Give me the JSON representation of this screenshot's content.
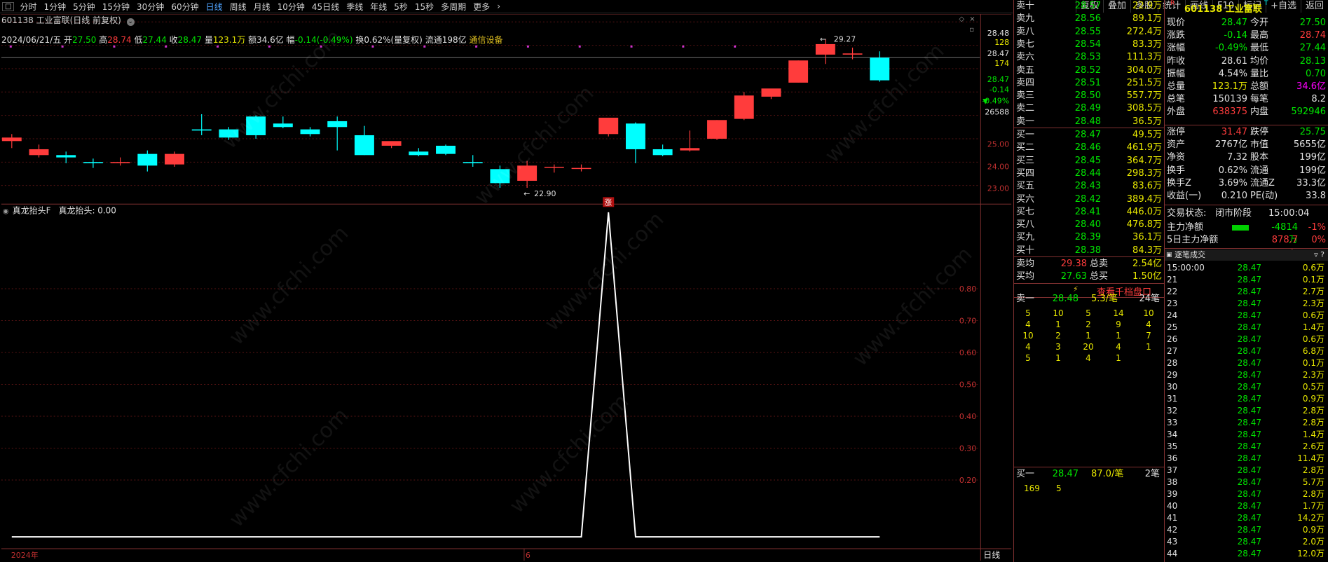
{
  "toolbar": {
    "periods": [
      "分时",
      "1分钟",
      "5分钟",
      "15分钟",
      "30分钟",
      "60分钟",
      "日线",
      "周线",
      "月线",
      "10分钟",
      "45日线",
      "季线",
      "年线",
      "5秒",
      "15秒",
      "多周期",
      "更多"
    ],
    "active_period": "日线",
    "right_tools": [
      "复权",
      "叠加",
      "多股",
      "统计",
      "画线",
      "F10",
      "标记",
      "+自选",
      "返回"
    ]
  },
  "security": {
    "code": "601138",
    "name": "工业富联",
    "title": "601138 工业富联(日线 前复权)"
  },
  "info_line": {
    "date": "2024/06/21/五",
    "open_label": "开",
    "open": "27.50",
    "high_label": "高",
    "high": "28.74",
    "low_label": "低",
    "low": "27.44",
    "close_label": "收",
    "close": "28.47",
    "vol_label": "量",
    "vol": "123.1万",
    "amount_label": "额",
    "amount": "34.6亿",
    "chg_label": "幅",
    "chg": "-0.14(-0.49%)",
    "turnover_label": "换",
    "turnover": "0.62%(量复权)",
    "float_label": "流通",
    "float": "198亿",
    "industry": "通信设备"
  },
  "price_axis": {
    "top": "28.48",
    "r2": "128",
    "r3": "28.47",
    "r4": "174",
    "r5": "28.47",
    "r6": "-0.14",
    "r7": "-0.49%",
    "r8": "26588",
    "l25": "25.00",
    "l24": "24.00",
    "l23": "23.00"
  },
  "chart_annotations": {
    "high_mark": "29.27",
    "low_mark": "22.90",
    "rise_badge": "涨"
  },
  "indicator": {
    "name": "真龙抬头F",
    "label": "真龙抬头: 0.00",
    "ticks": [
      "0.80",
      "0.70",
      "0.60",
      "0.50",
      "0.40",
      "0.30",
      "0.20"
    ]
  },
  "x_axis": {
    "start": "2024年",
    "mid": "6",
    "period_label": "日线"
  },
  "chart_data": {
    "type": "candlestick",
    "ylim": [
      22.5,
      29.5
    ],
    "candles": [
      {
        "o": 24.9,
        "h": 25.2,
        "l": 24.6,
        "c": 25.05
      },
      {
        "o": 24.3,
        "h": 24.75,
        "l": 24.2,
        "c": 24.55
      },
      {
        "o": 24.3,
        "h": 24.45,
        "l": 23.95,
        "c": 24.2
      },
      {
        "o": 24.0,
        "h": 24.15,
        "l": 23.75,
        "c": 23.95
      },
      {
        "o": 23.95,
        "h": 24.2,
        "l": 23.85,
        "c": 24.0
      },
      {
        "o": 24.35,
        "h": 24.5,
        "l": 23.6,
        "c": 23.85
      },
      {
        "o": 23.9,
        "h": 24.45,
        "l": 23.8,
        "c": 24.35
      },
      {
        "o": 25.4,
        "h": 26.05,
        "l": 25.15,
        "c": 25.35
      },
      {
        "o": 25.4,
        "h": 25.5,
        "l": 24.95,
        "c": 25.05
      },
      {
        "o": 25.95,
        "h": 26.0,
        "l": 25.0,
        "c": 25.15
      },
      {
        "o": 25.65,
        "h": 25.95,
        "l": 25.45,
        "c": 25.5
      },
      {
        "o": 25.4,
        "h": 25.5,
        "l": 25.1,
        "c": 25.2
      },
      {
        "o": 25.75,
        "h": 25.95,
        "l": 24.5,
        "c": 25.5
      },
      {
        "o": 25.15,
        "h": 25.55,
        "l": 24.3,
        "c": 24.3
      },
      {
        "o": 24.7,
        "h": 24.8,
        "l": 24.6,
        "c": 24.9
      },
      {
        "o": 24.45,
        "h": 24.6,
        "l": 24.25,
        "c": 24.3
      },
      {
        "o": 24.7,
        "h": 24.75,
        "l": 24.3,
        "c": 24.35
      },
      {
        "o": 24.0,
        "h": 24.3,
        "l": 23.8,
        "c": 23.95
      },
      {
        "o": 23.7,
        "h": 23.85,
        "l": 22.9,
        "c": 23.1
      },
      {
        "o": 23.2,
        "h": 24.05,
        "l": 22.9,
        "c": 23.85
      },
      {
        "o": 23.8,
        "h": 23.9,
        "l": 23.55,
        "c": 23.8
      },
      {
        "o": 23.75,
        "h": 23.9,
        "l": 23.6,
        "c": 23.75
      },
      {
        "o": 25.2,
        "h": 25.9,
        "l": 25.1,
        "c": 25.9
      },
      {
        "o": 25.65,
        "h": 25.7,
        "l": 23.95,
        "c": 24.55
      },
      {
        "o": 24.55,
        "h": 24.75,
        "l": 24.25,
        "c": 24.3
      },
      {
        "o": 24.5,
        "h": 25.35,
        "l": 24.45,
        "c": 24.6
      },
      {
        "o": 25.0,
        "h": 25.8,
        "l": 24.95,
        "c": 25.8
      },
      {
        "o": 25.85,
        "h": 27.0,
        "l": 25.8,
        "c": 26.85
      },
      {
        "o": 26.8,
        "h": 27.1,
        "l": 26.7,
        "c": 27.15
      },
      {
        "o": 27.4,
        "h": 28.35,
        "l": 27.4,
        "c": 28.35
      },
      {
        "o": 28.6,
        "h": 29.27,
        "l": 28.2,
        "c": 29.05
      },
      {
        "o": 28.6,
        "h": 28.9,
        "l": 28.4,
        "c": 28.65
      },
      {
        "o": 28.47,
        "h": 28.74,
        "l": 27.44,
        "c": 27.5
      }
    ],
    "indicator_series": [
      0,
      0,
      0,
      0,
      0,
      0,
      0,
      0,
      0,
      0,
      0,
      0,
      0,
      0,
      0,
      0,
      0,
      0,
      0,
      0,
      0,
      0,
      1,
      0,
      0,
      0,
      0,
      0,
      0,
      0,
      0,
      0,
      0
    ]
  },
  "book": {
    "sells": [
      {
        "label": "卖十",
        "px": "28.57",
        "vol": "22.9万"
      },
      {
        "label": "卖九",
        "px": "28.56",
        "vol": "89.1万"
      },
      {
        "label": "卖八",
        "px": "28.55",
        "vol": "272.4万"
      },
      {
        "label": "卖七",
        "px": "28.54",
        "vol": "83.3万"
      },
      {
        "label": "卖六",
        "px": "28.53",
        "vol": "111.3万"
      },
      {
        "label": "卖五",
        "px": "28.52",
        "vol": "304.0万"
      },
      {
        "label": "卖四",
        "px": "28.51",
        "vol": "251.5万"
      },
      {
        "label": "卖三",
        "px": "28.50",
        "vol": "557.7万"
      },
      {
        "label": "卖二",
        "px": "28.49",
        "vol": "308.5万"
      },
      {
        "label": "卖一",
        "px": "28.48",
        "vol": "36.5万"
      }
    ],
    "buys": [
      {
        "label": "买一",
        "px": "28.47",
        "vol": "49.5万"
      },
      {
        "label": "买二",
        "px": "28.46",
        "vol": "461.9万"
      },
      {
        "label": "买三",
        "px": "28.45",
        "vol": "364.7万"
      },
      {
        "label": "买四",
        "px": "28.44",
        "vol": "298.3万"
      },
      {
        "label": "买五",
        "px": "28.43",
        "vol": "83.6万"
      },
      {
        "label": "买六",
        "px": "28.42",
        "vol": "389.4万"
      },
      {
        "label": "买七",
        "px": "28.41",
        "vol": "446.0万"
      },
      {
        "label": "买八",
        "px": "28.40",
        "vol": "476.8万"
      },
      {
        "label": "买九",
        "px": "28.39",
        "vol": "36.1万"
      },
      {
        "label": "买十",
        "px": "28.38",
        "vol": "84.3万"
      }
    ],
    "avg_sell_label": "卖均",
    "avg_sell": "29.38",
    "total_sell_label": "总卖",
    "total_sell": "2.54亿",
    "avg_buy_label": "买均",
    "avg_buy": "27.63",
    "total_buy_label": "总买",
    "total_buy": "1.50亿",
    "thousand_link": "查看千档盘口",
    "sell1_label": "卖一",
    "sell1_px": "28.48",
    "sell1_avg": "5.3/笔",
    "sell1_count": "24笔",
    "sell1_queue": [
      [
        "5",
        "10",
        "5",
        "14",
        "10"
      ],
      [
        "4",
        "1",
        "2",
        "9",
        "4"
      ],
      [
        "10",
        "2",
        "1",
        "1",
        "7"
      ],
      [
        "4",
        "3",
        "20",
        "4",
        "1"
      ],
      [
        "5",
        "1",
        "4",
        "1",
        ""
      ]
    ],
    "buy1_label": "买一",
    "buy1_px": "28.47",
    "buy1_avg": "87.0/笔",
    "buy1_count": "2笔",
    "buy1_queue": [
      "169",
      "5"
    ]
  },
  "quote": {
    "title": "601138 工业富联",
    "rows": [
      {
        "l1": "现价",
        "v1": "28.47",
        "c1": "green",
        "l2": "今开",
        "v2": "27.50",
        "c2": "green"
      },
      {
        "l1": "涨跌",
        "v1": "-0.14",
        "c1": "green",
        "l2": "最高",
        "v2": "28.74",
        "c2": "red"
      },
      {
        "l1": "涨幅",
        "v1": "-0.49%",
        "c1": "green",
        "l2": "最低",
        "v2": "27.44",
        "c2": "green"
      },
      {
        "l1": "昨收",
        "v1": "28.61",
        "c1": "white",
        "l2": "均价",
        "v2": "28.13",
        "c2": "green"
      },
      {
        "l1": "振幅",
        "v1": "4.54%",
        "c1": "white",
        "l2": "量比",
        "v2": "0.70",
        "c2": "green"
      },
      {
        "l1": "总量",
        "v1": "123.1万",
        "c1": "yellow",
        "l2": "总额",
        "v2": "34.6亿",
        "c2": "mag"
      },
      {
        "l1": "总笔",
        "v1": "150139",
        "c1": "white",
        "l2": "每笔",
        "v2": "8.2",
        "c2": "white"
      },
      {
        "l1": "外盘",
        "v1": "638375",
        "c1": "red",
        "l2": "内盘",
        "v2": "592946",
        "c2": "green"
      }
    ],
    "rows2": [
      {
        "l1": "涨停",
        "v1": "31.47",
        "c1": "red",
        "l2": "跌停",
        "v2": "25.75",
        "c2": "green"
      },
      {
        "l1": "资产",
        "v1": "2767亿",
        "c1": "white",
        "l2": "市值",
        "v2": "5655亿",
        "c2": "white"
      },
      {
        "l1": "净资",
        "v1": "7.32",
        "c1": "white",
        "l2": "股本",
        "v2": "199亿",
        "c2": "white"
      },
      {
        "l1": "换手",
        "v1": "0.62%",
        "c1": "white",
        "l2": "流通",
        "v2": "199亿",
        "c2": "white"
      },
      {
        "l1": "换手Z",
        "v1": "3.69%",
        "c1": "white",
        "l2": "流通Z",
        "v2": "33.3亿",
        "c2": "white"
      },
      {
        "l1": "收益(一)",
        "v1": "0.210",
        "c1": "white",
        "l2": "PE(动)",
        "v2": "33.8",
        "c2": "white"
      }
    ],
    "trade_state_label": "交易状态:",
    "trade_state": "闭市阶段",
    "trade_time": "15:00:04",
    "main_net_label": "主力净额",
    "main_net": "-4814万",
    "main_net_pct": "-1%",
    "main5_label": "5日主力净额",
    "main5": "878.7万",
    "main5_pct": "0%",
    "ticks_title": "逐笔成交",
    "ticks": [
      {
        "t": "15:00:00",
        "p": "28.47",
        "v": "0.6万"
      },
      {
        "t": "21",
        "p": "28.47",
        "v": "0.1万"
      },
      {
        "t": "22",
        "p": "28.47",
        "v": "2.7万"
      },
      {
        "t": "23",
        "p": "28.47",
        "v": "2.3万"
      },
      {
        "t": "24",
        "p": "28.47",
        "v": "0.6万"
      },
      {
        "t": "25",
        "p": "28.47",
        "v": "1.4万"
      },
      {
        "t": "26",
        "p": "28.47",
        "v": "0.6万"
      },
      {
        "t": "27",
        "p": "28.47",
        "v": "6.8万"
      },
      {
        "t": "28",
        "p": "28.47",
        "v": "0.1万"
      },
      {
        "t": "29",
        "p": "28.47",
        "v": "2.3万"
      },
      {
        "t": "30",
        "p": "28.47",
        "v": "0.5万"
      },
      {
        "t": "31",
        "p": "28.47",
        "v": "0.9万"
      },
      {
        "t": "32",
        "p": "28.47",
        "v": "2.8万"
      },
      {
        "t": "33",
        "p": "28.47",
        "v": "2.8万"
      },
      {
        "t": "34",
        "p": "28.47",
        "v": "1.4万"
      },
      {
        "t": "35",
        "p": "28.47",
        "v": "2.6万"
      },
      {
        "t": "36",
        "p": "28.47",
        "v": "11.4万"
      },
      {
        "t": "37",
        "p": "28.47",
        "v": "2.8万"
      },
      {
        "t": "38",
        "p": "28.47",
        "v": "5.7万"
      },
      {
        "t": "39",
        "p": "28.47",
        "v": "2.8万"
      },
      {
        "t": "40",
        "p": "28.47",
        "v": "1.7万"
      },
      {
        "t": "41",
        "p": "28.47",
        "v": "14.2万"
      },
      {
        "t": "42",
        "p": "28.47",
        "v": "0.9万"
      },
      {
        "t": "43",
        "p": "28.47",
        "v": "2.0万"
      },
      {
        "t": "44",
        "p": "28.47",
        "v": "12.0万"
      }
    ]
  },
  "watermark": "www.cfchi.com",
  "colors": {
    "up": "#ff3c3c",
    "down": "#00ffff",
    "grid": "#6a1a1a",
    "axis": "#c03030"
  }
}
